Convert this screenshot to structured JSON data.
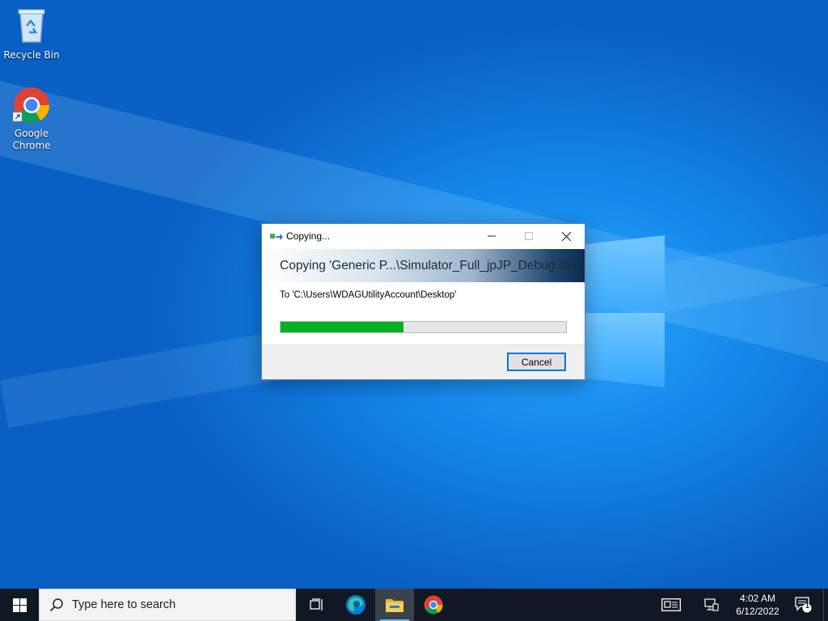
{
  "desktop": {
    "icons": [
      {
        "label": "Recycle Bin",
        "icon": "recycle-bin-icon"
      },
      {
        "label": "Google\nChrome",
        "icon": "chrome-icon"
      }
    ]
  },
  "dialog": {
    "title": "Copying...",
    "heading": "Copying 'Generic P...\\Simulator_Full_jpJP_Debug.rom'",
    "destination": "To 'C:\\Users\\WDAGUtilityAccount\\Desktop'",
    "progress_fraction": 0.43,
    "progress_color": "#06b025",
    "cancel_label": "Cancel",
    "window_buttons": [
      "minimize",
      "maximize",
      "close"
    ]
  },
  "taskbar": {
    "search_placeholder": "Type here to search",
    "pinned": [
      "task-view-icon",
      "edge-icon",
      "file-explorer-icon",
      "chrome-icon"
    ],
    "active_app": "file-explorer-icon",
    "clock": {
      "time": "4:02 AM",
      "date": "6/12/2022"
    },
    "notification_count": "1",
    "accent_color": "#76b9ed"
  }
}
